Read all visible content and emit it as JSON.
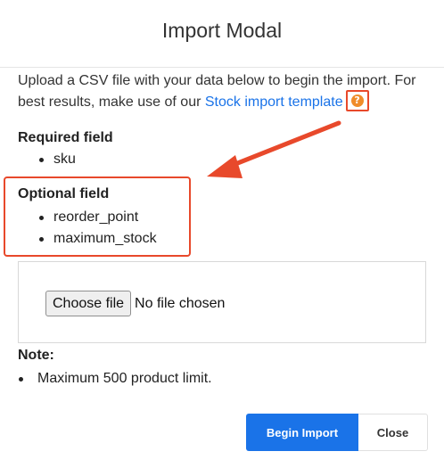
{
  "modal": {
    "title": "Import Modal"
  },
  "intro": {
    "text_before_link": "Upload a CSV file with your data below to begin the import. For best results, make use of our ",
    "link_text": "Stock import template",
    "help_icon": "question-circle-icon",
    "help_glyph": "?"
  },
  "required": {
    "title": "Required field",
    "items": [
      "sku"
    ]
  },
  "optional": {
    "title": "Optional field",
    "items": [
      "reorder_point",
      "maximum_stock"
    ]
  },
  "file_input": {
    "button_label": "Choose file",
    "status": "No file chosen"
  },
  "note": {
    "title": "Note:",
    "items": [
      "Maximum 500 product limit."
    ]
  },
  "footer": {
    "begin_label": "Begin Import",
    "close_label": "Close"
  },
  "colors": {
    "accent": "#1a73e8",
    "annotation": "#e8492b",
    "help_icon": "#f08c2a"
  }
}
